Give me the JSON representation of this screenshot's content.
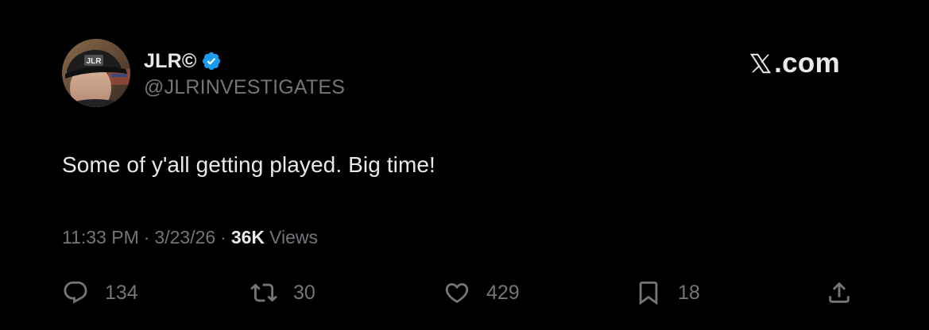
{
  "author": {
    "display_name": "JLR©",
    "handle": "@JLRINVESTIGATES",
    "verified": true,
    "avatar_cap_text": "JLR"
  },
  "brand": {
    "label": ".com",
    "logo_icon": "x-logo-icon"
  },
  "tweet": {
    "text": "Some of y'all getting played. Big time!"
  },
  "meta": {
    "time": "11:33 PM",
    "separator": "·",
    "date": "3/23/26",
    "views_count": "36K",
    "views_label": "Views"
  },
  "actions": {
    "reply_count": "134",
    "repost_count": "30",
    "like_count": "429",
    "bookmark_count": "18"
  },
  "colors": {
    "background": "#000000",
    "primary_text": "#e7e9ea",
    "secondary_text": "#71767b",
    "verified_badge": "#1d9bf0"
  }
}
